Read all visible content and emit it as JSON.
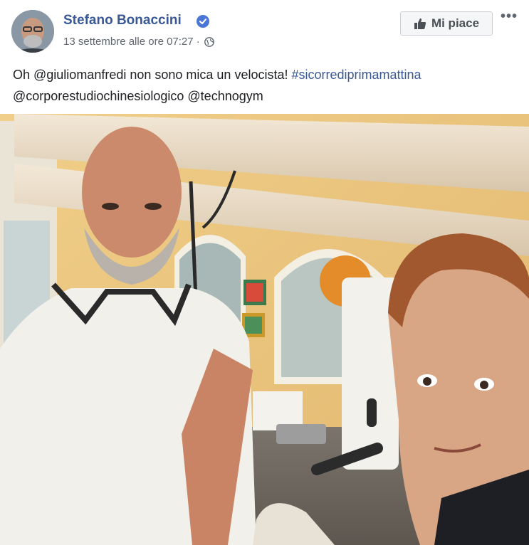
{
  "post": {
    "author": "Stefano Bonaccini",
    "verified_icon": "verified-badge-icon",
    "timestamp": "13 settembre alle ore 07:27",
    "separator": " · ",
    "privacy_icon": "globe-icon",
    "like_button_label": "Mi piace",
    "more_icon": "•••",
    "text_line1_plain": "Oh @giuliomanfredi non sono mica un velocista! ",
    "text_line1_hashtag": "#sicorrediprimamattina",
    "text_line2": "@corporestudiochinesiologico @technogym",
    "colors": {
      "link": "#385898",
      "meta": "#606770",
      "button_bg": "#f5f6f7"
    }
  }
}
